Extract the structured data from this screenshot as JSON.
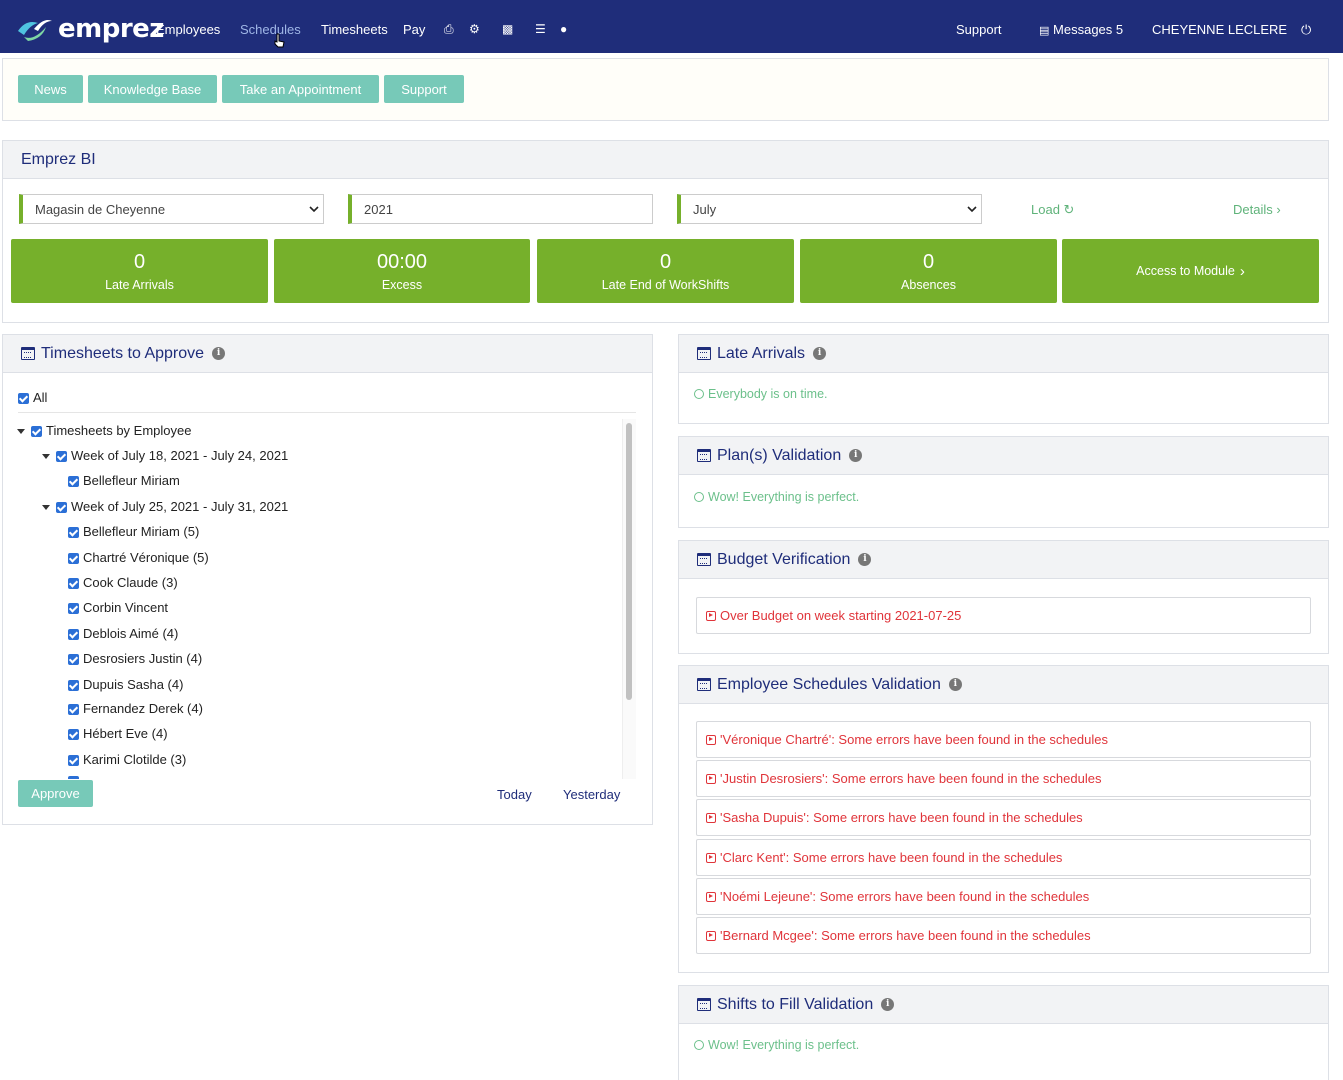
{
  "nav": {
    "logo": "emprez",
    "links": [
      "Employees",
      "Schedules",
      "Timesheets",
      "Pay"
    ],
    "right": {
      "support": "Support",
      "messages": "Messages 5",
      "user": "CHEYENNE LECLERE"
    }
  },
  "top_buttons": [
    "News",
    "Knowledge Base",
    "Take an Appointment",
    "Support"
  ],
  "bi": {
    "title": "Emprez BI",
    "store": "Magasin de Cheyenne",
    "year": "2021",
    "month": "July",
    "load": "Load",
    "details": "Details",
    "tiles": [
      {
        "value": "0",
        "label": "Late Arrivals"
      },
      {
        "value": "00:00",
        "label": "Excess"
      },
      {
        "value": "0",
        "label": "Late End of WorkShifts"
      },
      {
        "value": "0",
        "label": "Absences"
      }
    ],
    "access": "Access to Module"
  },
  "timesheets": {
    "title": "Timesheets to Approve",
    "all": "All",
    "root": "Timesheets by Employee",
    "week1": "Week of July 18, 2021 - July 24, 2021",
    "week1_emp": [
      "Bellefleur Miriam"
    ],
    "week2": "Week of July 25, 2021 - July 31, 2021",
    "week2_emp": [
      "Bellefleur Miriam (5)",
      "Chartré Véronique (5)",
      "Cook Claude (3)",
      "Corbin Vincent",
      "Deblois Aimé (4)",
      "Desrosiers Justin (4)",
      "Dupuis Sasha (4)",
      "Fernandez Derek (4)",
      "Hébert Eve (4)",
      "Karimi Clotilde (3)"
    ],
    "approve": "Approve",
    "today": "Today",
    "yesterday": "Yesterday"
  },
  "late_arrivals": {
    "title": "Late Arrivals",
    "msg": "Everybody is on time."
  },
  "plans": {
    "title": "Plan(s) Validation",
    "msg": "Wow! Everything is perfect."
  },
  "budget": {
    "title": "Budget Verification",
    "msg": "Over Budget on week starting 2021-07-25"
  },
  "emp_sched": {
    "title": "Employee Schedules Validation",
    "items": [
      "'Véronique Chartré': Some errors have been found in the schedules",
      "'Justin Desrosiers': Some errors have been found in the schedules",
      "'Sasha Dupuis': Some errors have been found in the schedules",
      "'Clarc Kent': Some errors have been found in the schedules",
      "'Noémi Lejeune': Some errors have been found in the schedules",
      "'Bernard Mcgee': Some errors have been found in the schedules"
    ]
  },
  "shifts": {
    "title": "Shifts to Fill Validation",
    "msg": "Wow! Everything is perfect."
  }
}
